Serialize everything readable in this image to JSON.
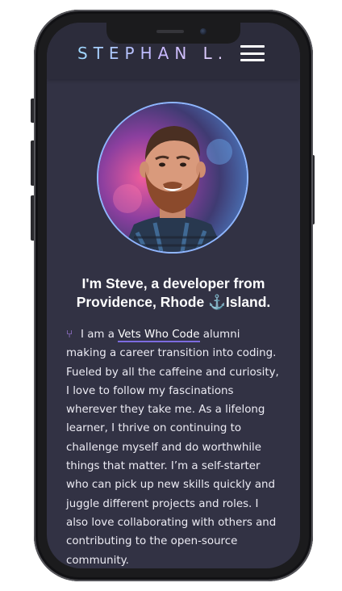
{
  "header": {
    "brand": "STEPHAN L.",
    "menu_icon": "hamburger-menu-icon"
  },
  "profile": {
    "photo_icon": "profile-photo"
  },
  "intro": {
    "headline_part1": "I'm Steve, a developer from Providence, Rhode ",
    "anchor_glyph": "⚓",
    "headline_part2": "Island."
  },
  "bio": {
    "icon": "git-branch-icon",
    "icon_glyph": "⑂",
    "text_before_link": "I am a ",
    "link_text": "Vets Who Code",
    "text_after_link": " alumni making a career transition into coding. Fueled by all the caffeine and curiosity, I love to follow my fascinations wherever they take me. As a lifelong learner, I thrive on continuing to challenge myself and do worthwhile things that matter. I’m a self-starter who can pick up new skills quickly and juggle different projects and roles. I also love collaborating with others and contributing to the open-source community."
  },
  "colors": {
    "screen_bg": "#323244",
    "navbar_bg": "#2c2c3b",
    "accent": "#7c6be0",
    "anchor": "#4aa8e6"
  }
}
